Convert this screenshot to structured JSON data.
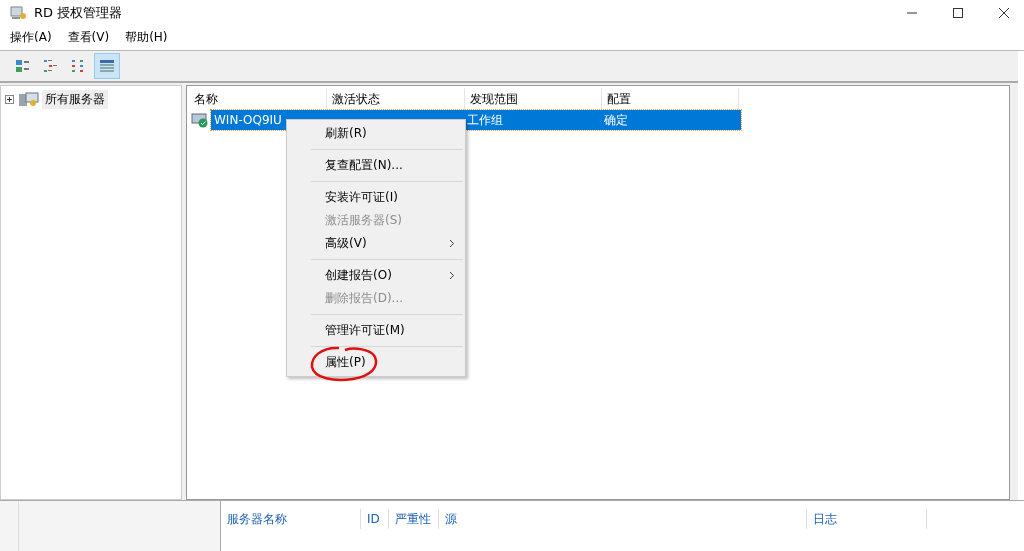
{
  "window": {
    "title": "RD 授权管理器"
  },
  "menu": [
    "操作(A)",
    "查看(V)",
    "帮助(H)"
  ],
  "toolbar": [
    {
      "kind": "large",
      "selected": false
    },
    {
      "kind": "small",
      "selected": false
    },
    {
      "kind": "list",
      "selected": false
    },
    {
      "kind": "details",
      "selected": true
    }
  ],
  "tree": {
    "label": "所有服务器",
    "expanded": false
  },
  "table": {
    "columns": [
      "名称",
      "激活状态",
      "发现范围",
      "配置"
    ],
    "rows": [
      {
        "name": "WIN-OQ9IU",
        "discovery": "工作组",
        "config": "确定",
        "selected": true
      }
    ]
  },
  "context_menu": [
    {
      "kind": "item",
      "label": "刷新(R)",
      "disabled": false,
      "submenu": false
    },
    {
      "kind": "separator"
    },
    {
      "kind": "item",
      "label": "复查配置(N)...",
      "disabled": false,
      "submenu": false
    },
    {
      "kind": "separator"
    },
    {
      "kind": "item",
      "label": "安装许可证(I)",
      "disabled": false,
      "submenu": false
    },
    {
      "kind": "item",
      "label": "激活服务器(S)",
      "disabled": true,
      "submenu": false
    },
    {
      "kind": "item",
      "label": "高级(V)",
      "disabled": false,
      "submenu": true
    },
    {
      "kind": "separator"
    },
    {
      "kind": "item",
      "label": "创建报告(O)",
      "disabled": false,
      "submenu": true
    },
    {
      "kind": "item",
      "label": "删除报告(D)...",
      "disabled": true,
      "submenu": false
    },
    {
      "kind": "separator"
    },
    {
      "kind": "item",
      "label": "管理许可证(M)",
      "disabled": false,
      "submenu": false
    },
    {
      "kind": "separator"
    },
    {
      "kind": "item",
      "label": "属性(P)",
      "disabled": false,
      "submenu": false,
      "circled": true
    }
  ],
  "event_table": {
    "columns": [
      "服务器名称",
      "ID",
      "严重性",
      "源",
      "日志"
    ]
  }
}
